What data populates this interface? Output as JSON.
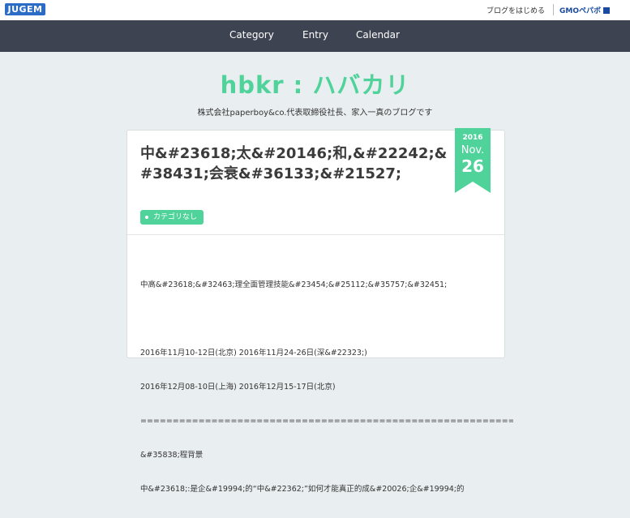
{
  "topbar": {
    "logo": "JUGEM",
    "start_blog_link": "ブログをはじめる",
    "gmo_link": "GMOペパボ"
  },
  "nav": {
    "items": [
      {
        "label": "Category"
      },
      {
        "label": "Entry"
      },
      {
        "label": "Calendar"
      }
    ]
  },
  "site": {
    "title": "hbkr : ハバカリ",
    "description": "株式会社paperboy&co.代表取締役社長、家入一真のブログです"
  },
  "post": {
    "title": "中&#23618;太&#20146;和,&#22242;&#38431;会衰&#36133;&#21527;",
    "date": {
      "year": "2016",
      "month": "Nov.",
      "day": "26"
    },
    "category": "カテゴリなし",
    "body_lines": [
      "中高&#23618;&#32463;理全面管理技能&#23454;&#25112;&#35757;&#32451;",
      "",
      "2016年11月10-12日(北京) 2016年11月24-26日(深&#22323;)",
      "2016年12月08-10日(上海) 2016年12月15-17日(北京)",
      "==============================================================",
      "&#35838;程背景",
      "中&#23618;:是企&#19994;的“中&#22362;”如何才能真正的成&#20026;企&#19994;的"
    ]
  },
  "colors": {
    "accent": "#4fd39a",
    "nav_bg": "#3e4352",
    "page_bg": "#e9eef0"
  }
}
